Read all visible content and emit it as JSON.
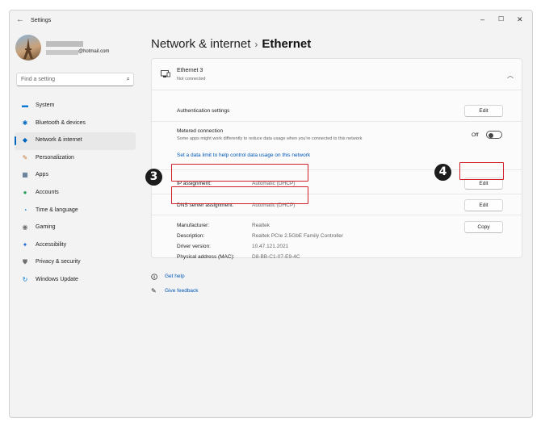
{
  "window": {
    "title": "Settings",
    "back_icon": "←",
    "min": "–",
    "max": "☐",
    "close": "✕"
  },
  "profile": {
    "email_suffix": "@hotmail.com"
  },
  "search": {
    "placeholder": "Find a setting",
    "icon": "⌕"
  },
  "nav": {
    "items": [
      {
        "label": "System",
        "icon": "▬",
        "color": "#0078d4"
      },
      {
        "label": "Bluetooth & devices",
        "icon": "✱",
        "color": "#0067c0"
      },
      {
        "label": "Network & internet",
        "icon": "◆",
        "color": "#0067c0"
      },
      {
        "label": "Personalization",
        "icon": "✎",
        "color": "#c57b3a"
      },
      {
        "label": "Apps",
        "icon": "▦",
        "color": "#3c5a7a"
      },
      {
        "label": "Accounts",
        "icon": "●",
        "color": "#2a9d5f"
      },
      {
        "label": "Time & language",
        "icon": "◔",
        "color": "#1e88c8"
      },
      {
        "label": "Gaming",
        "icon": "◉",
        "color": "#707070"
      },
      {
        "label": "Accessibility",
        "icon": "✦",
        "color": "#1e6bd6"
      },
      {
        "label": "Privacy & security",
        "icon": "⛊",
        "color": "#707070"
      },
      {
        "label": "Windows Update",
        "icon": "↻",
        "color": "#0078d4"
      }
    ],
    "active_index": 2
  },
  "breadcrumb": {
    "parent": "Network & internet",
    "separator": "›",
    "current": "Ethernet"
  },
  "adapter": {
    "name": "Ethernet 3",
    "status": "Not connected",
    "chevron": "︿"
  },
  "auth": {
    "label": "Authentication settings",
    "button": "Edit"
  },
  "metered": {
    "label": "Metered connection",
    "description": "Some apps might work differently to reduce data usage when you're connected to this network",
    "toggle_text": "Off",
    "toggle_on": false,
    "link": "Set a data limit to help control data usage on this network"
  },
  "ip": {
    "label": "IP assignment:",
    "value": "Automatic (DHCP)",
    "button": "Edit"
  },
  "dns": {
    "label": "DNS server assignment:",
    "value": "Automatic (DHCP)",
    "button": "Edit"
  },
  "properties": {
    "rows": [
      {
        "label": "Manufacturer:",
        "value": "Realtek"
      },
      {
        "label": "Description:",
        "value": "Realtek PCIe 2.5GbE Family Controller"
      },
      {
        "label": "Driver version:",
        "value": "10.47.121.2021"
      },
      {
        "label": "Physical address (MAC):",
        "value": "D8-BB-C1-07-E9-4C"
      }
    ],
    "button": "Copy"
  },
  "help": {
    "get_help": "Get help",
    "give_feedback": "Give feedback"
  },
  "annotations": {
    "badge_3": "3",
    "badge_4": "4",
    "highlight_color": "#d1202a"
  }
}
